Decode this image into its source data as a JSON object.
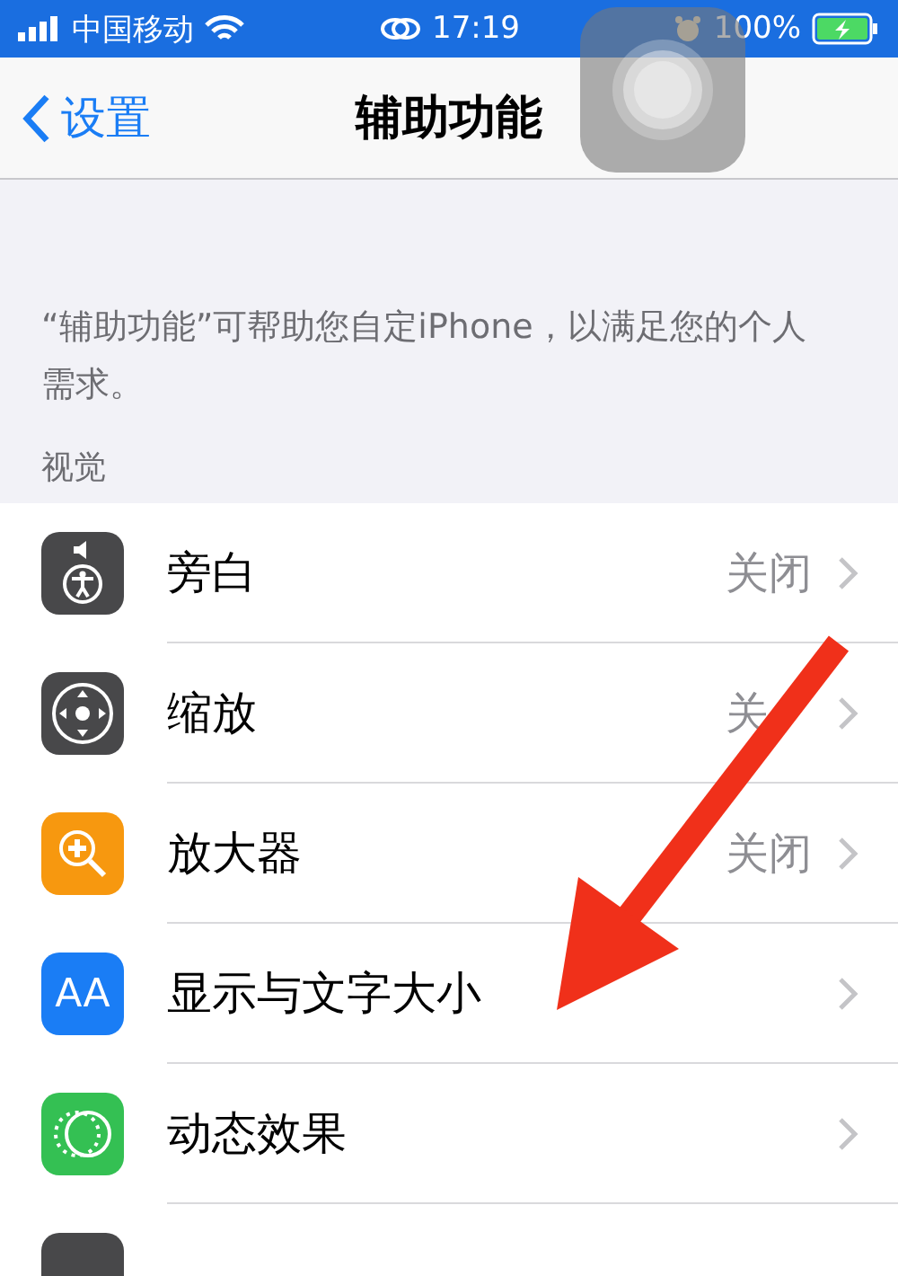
{
  "status_bar": {
    "carrier": "中国移动",
    "time": "17:19",
    "battery": "100%"
  },
  "nav": {
    "back": "设置",
    "title": "辅助功能"
  },
  "description": "“辅助功能”可帮助您自定iPhone，以满足您的个人需求。",
  "section": "视觉",
  "rows": [
    {
      "kind": "voiceover",
      "label": "旁白",
      "value": "关闭",
      "color": "#48484a"
    },
    {
      "kind": "zoom",
      "label": "缩放",
      "value": "关",
      "color": "#48484a"
    },
    {
      "kind": "magnifier",
      "label": "放大器",
      "value": "关闭",
      "color": "#f7980f"
    },
    {
      "kind": "display",
      "label": "显示与文字大小",
      "color": "#1a7df5",
      "icon_text": "AA"
    },
    {
      "kind": "motion",
      "label": "动态效果",
      "color": "#34c053"
    },
    {
      "kind": "partial",
      "color": "#48484a"
    }
  ]
}
